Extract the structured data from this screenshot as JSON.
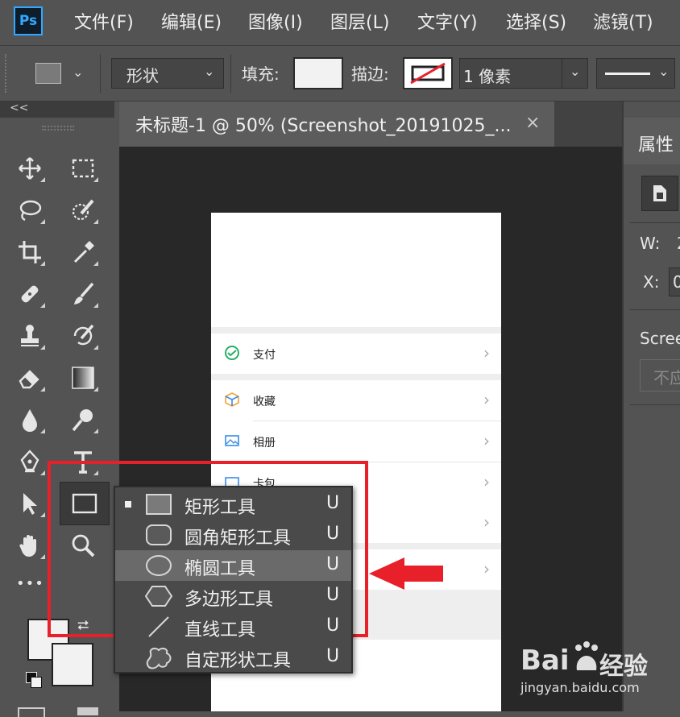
{
  "app": {
    "logo": "Ps"
  },
  "menu": [
    "文件(F)",
    "编辑(E)",
    "图像(I)",
    "图层(L)",
    "文字(Y)",
    "选择(S)",
    "滤镜(T)"
  ],
  "options": {
    "mode_select": "形状",
    "fill_label": "填充:",
    "stroke_label": "描边:",
    "stroke_width": "1 像素"
  },
  "panel_collapse": "<<",
  "document": {
    "tab_title": "未标题-1 @ 50% (Screenshot_20191025_...",
    "close_glyph": "×",
    "rows": [
      {
        "label": "支付",
        "icon": "wechat-pay-icon"
      },
      {
        "label": "收藏",
        "icon": "cube-icon"
      },
      {
        "label": "相册",
        "icon": "image-icon"
      },
      {
        "label": "卡包",
        "icon": "card-icon"
      }
    ],
    "chevron": "›"
  },
  "properties": {
    "title": "属性",
    "w_label": "W:",
    "w_value": "2",
    "x_label": "X:",
    "x_value": "0",
    "layer_name": "Scree",
    "button_label": "不应"
  },
  "toolbar_more": "•••",
  "flyout": {
    "items": [
      {
        "label": "矩形工具",
        "key": "U",
        "icon": "rectangle-icon",
        "active": true
      },
      {
        "label": "圆角矩形工具",
        "key": "U",
        "icon": "rounded-rectangle-icon",
        "active": false
      },
      {
        "label": "椭圆工具",
        "key": "U",
        "icon": "ellipse-icon",
        "active": false
      },
      {
        "label": "多边形工具",
        "key": "U",
        "icon": "polygon-icon",
        "active": false
      },
      {
        "label": "直线工具",
        "key": "U",
        "icon": "line-icon",
        "active": false
      },
      {
        "label": "自定形状工具",
        "key": "U",
        "icon": "custom-shape-icon",
        "active": false
      }
    ]
  },
  "watermark": {
    "brand": "Bai",
    "brand2": "经验",
    "url": "jingyan.baidu.com"
  },
  "colors": {
    "highlight_red": "#e8202a",
    "ps_blue": "#31a8ff",
    "panel_bg": "#535353"
  }
}
